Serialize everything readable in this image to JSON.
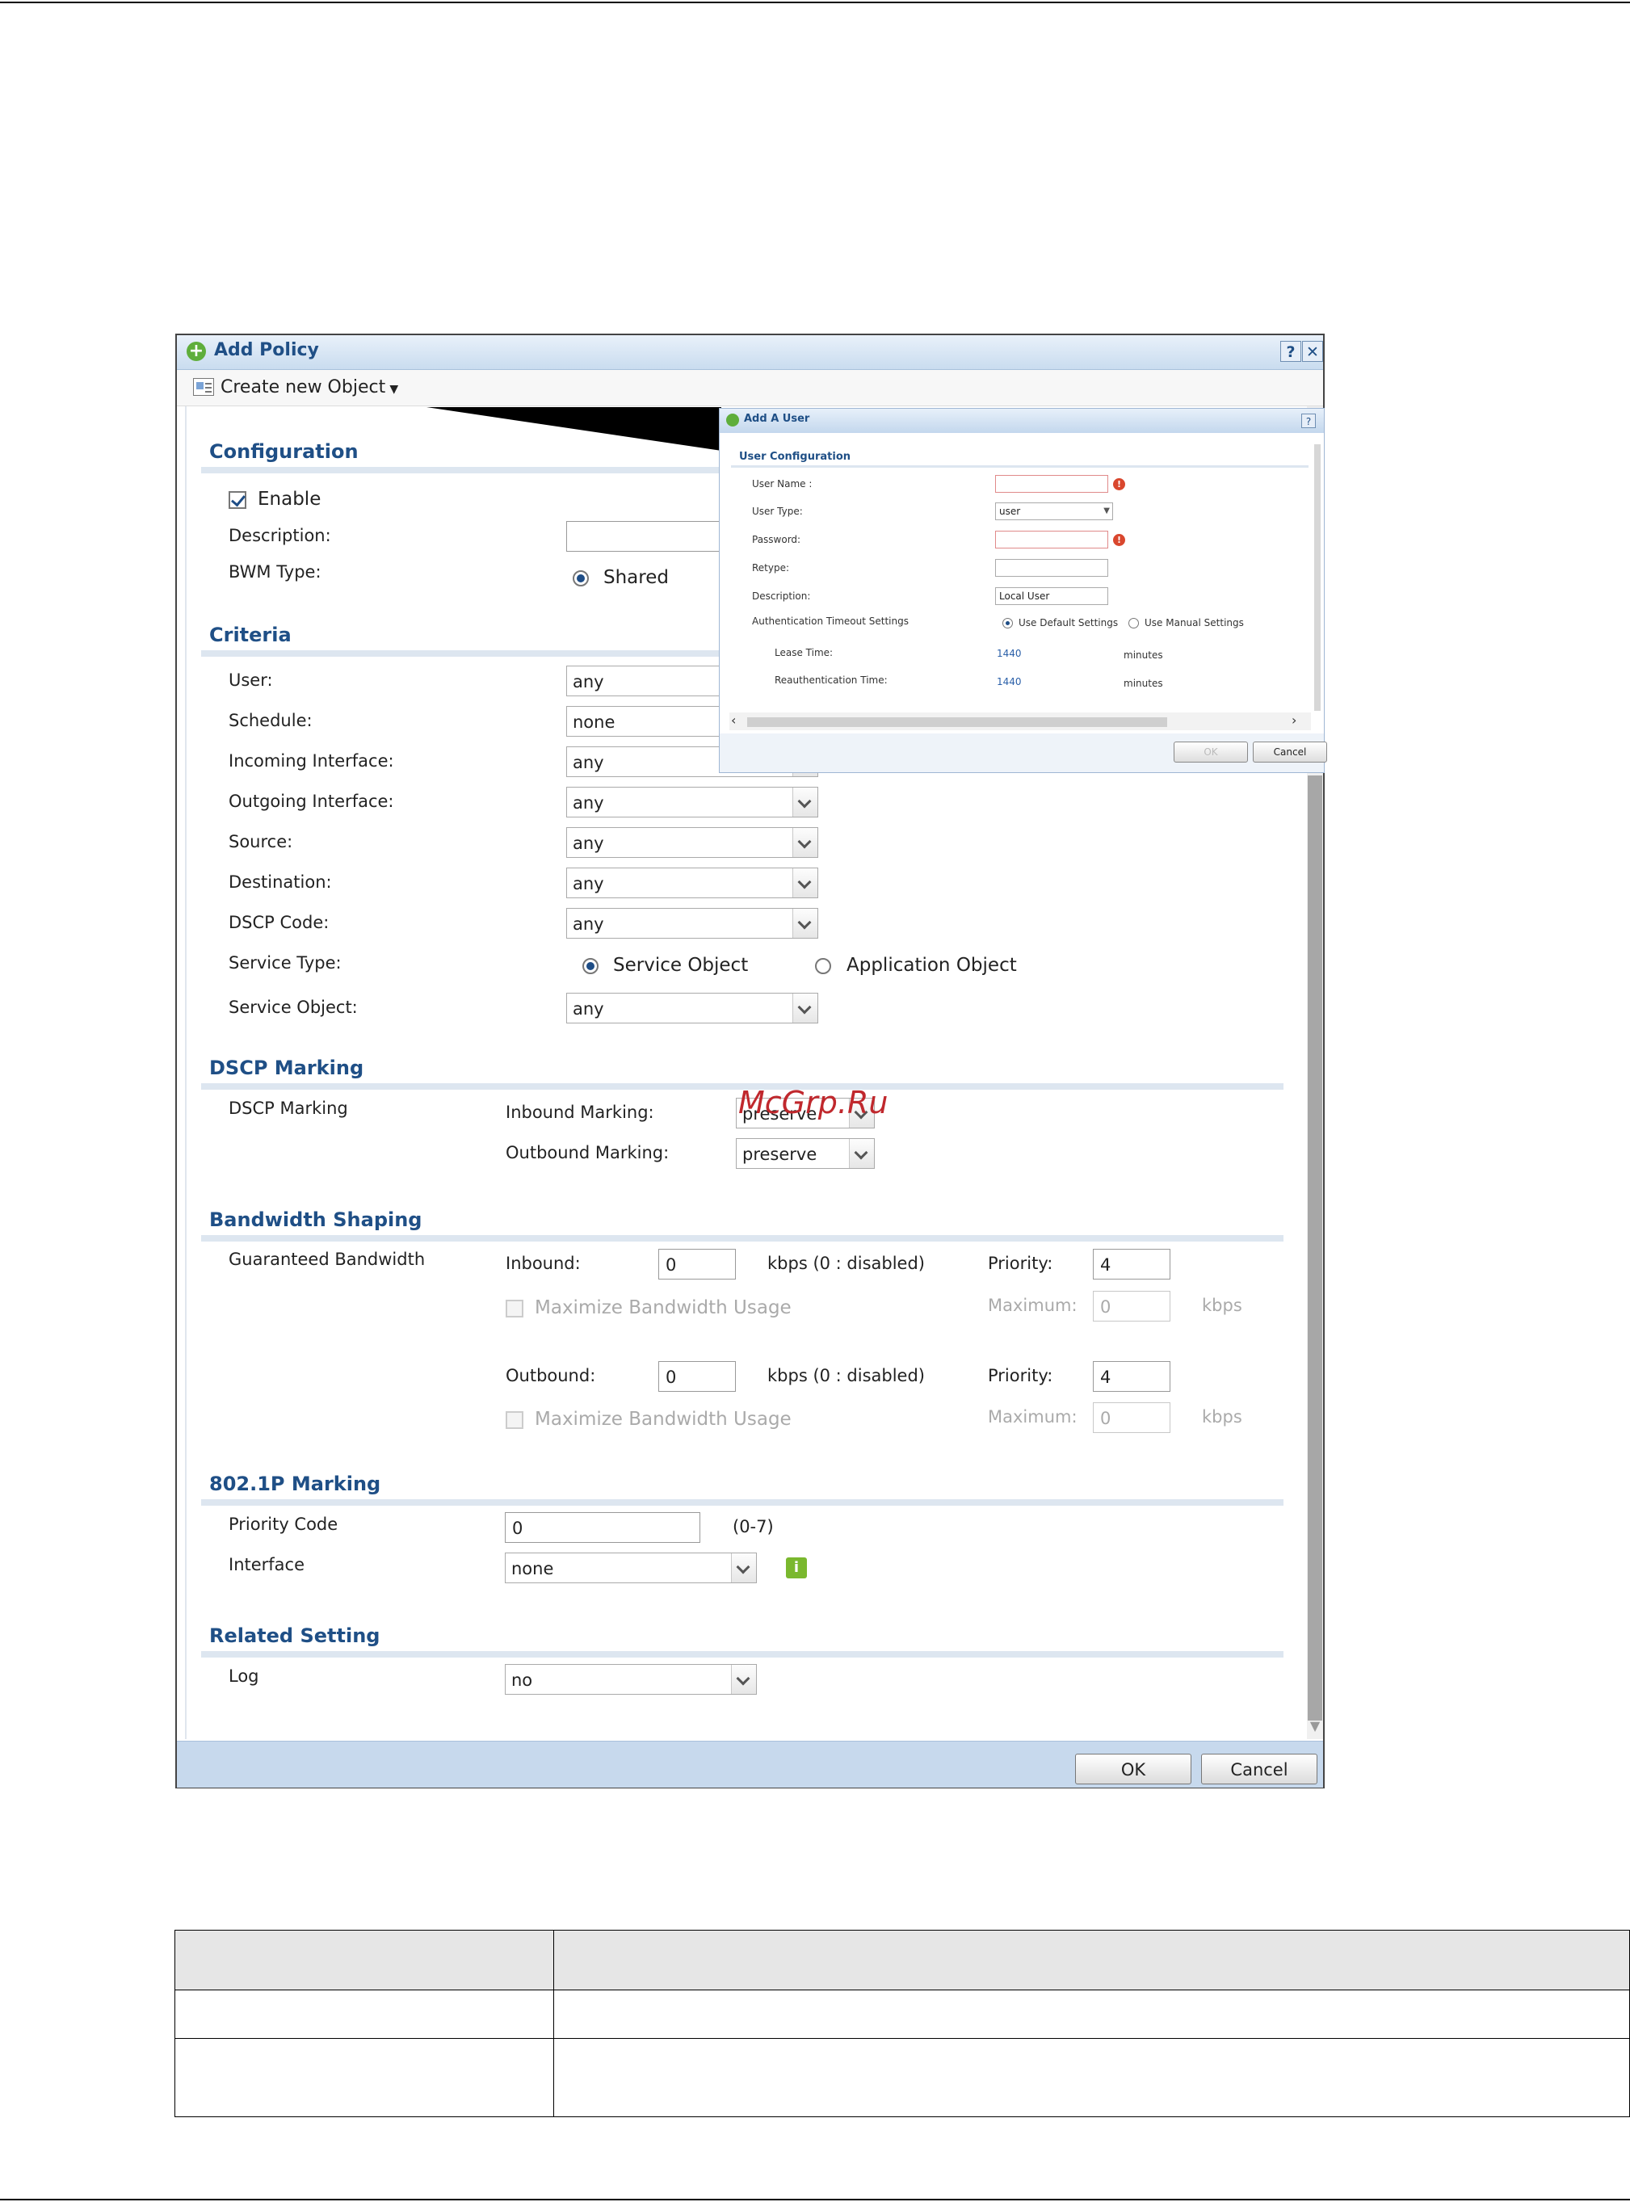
{
  "dialog": {
    "title": "Add Policy",
    "help_label": "?",
    "close_label": "✕",
    "toolbar_label": "Create new Object",
    "sections": {
      "configuration": "Configuration",
      "criteria": "Criteria",
      "dscp_marking": "DSCP Marking",
      "bandwidth_shaping": "Bandwidth Shaping",
      "p8021_marking": "802.1P Marking",
      "related_setting": "Related Setting"
    },
    "configuration": {
      "enable_label": "Enable",
      "enable_checked": true,
      "description_label": "Description:",
      "description_value": "",
      "bwm_type_label": "BWM Type:",
      "bwm_type_option": "Shared"
    },
    "criteria": {
      "user_label": "User:",
      "user_value": "any",
      "schedule_label": "Schedule:",
      "schedule_value": "none",
      "incoming_label": "Incoming Interface:",
      "incoming_value": "any",
      "outgoing_label": "Outgoing Interface:",
      "outgoing_value": "any",
      "source_label": "Source:",
      "source_value": "any",
      "destination_label": "Destination:",
      "destination_value": "any",
      "dscp_label": "DSCP Code:",
      "dscp_value": "any",
      "service_type_label": "Service Type:",
      "service_object_option": "Service Object",
      "application_object_option": "Application Object",
      "service_object_label": "Service Object:",
      "service_object_value": "any"
    },
    "dscp": {
      "row_label": "DSCP Marking",
      "inbound_label": "Inbound Marking:",
      "inbound_value": "preserve",
      "outbound_label": "Outbound Marking:",
      "outbound_value": "preserve"
    },
    "bandwidth": {
      "row_label": "Guaranteed Bandwidth",
      "inbound_label": "Inbound:",
      "inbound_value": "0",
      "kbps_disabled": "kbps (0 : disabled)",
      "priority_label": "Priority:",
      "inbound_priority": "4",
      "maximize_label": "Maximize Bandwidth Usage",
      "maximum_label": "Maximum:",
      "inbound_maximum": "0",
      "kbps": "kbps",
      "outbound_label": "Outbound:",
      "outbound_value": "0",
      "outbound_priority": "4",
      "outbound_maximum": "0"
    },
    "p8021": {
      "priority_code_label": "Priority Code",
      "priority_code_value": "0",
      "range": "(0-7)",
      "interface_label": "Interface",
      "interface_value": "none",
      "info_label": "i"
    },
    "related": {
      "log_label": "Log",
      "log_value": "no"
    },
    "ok_label": "OK",
    "cancel_label": "Cancel"
  },
  "sub_dialog": {
    "title": "Add A User",
    "help_label": "?",
    "section": "User Configuration",
    "user_name_label": "User Name :",
    "user_type_label": "User Type:",
    "user_type_value": "user",
    "password_label": "Password:",
    "retype_label": "Retype:",
    "description_label": "Description:",
    "description_value": "Local User",
    "auth_timeout_label": "Authentication Timeout Settings",
    "use_default": "Use Default Settings",
    "use_manual": "Use Manual Settings",
    "lease_time_label": "Lease Time:",
    "lease_time_value": "1440",
    "reauth_label": "Reauthentication Time:",
    "reauth_value": "1440",
    "minutes": "minutes",
    "warn": "!",
    "ok_label": "OK",
    "cancel_label": "Cancel"
  },
  "watermark": "McGrp.Ru",
  "colors": {
    "accent": "#1f4f86",
    "titlebar": "#c9dcef",
    "footer": "#c7d9ed",
    "warning": "#d9472e",
    "info": "#7ab82e"
  }
}
